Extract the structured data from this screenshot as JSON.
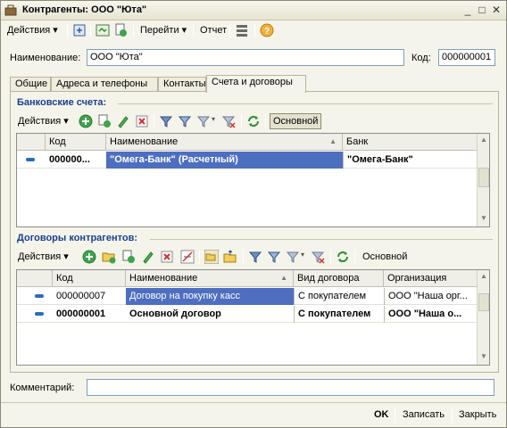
{
  "window": {
    "title": "Контрагенты: ООО \"Юта\""
  },
  "toolbar": {
    "actions": "Действия",
    "goto": "Перейти",
    "report": "Отчет"
  },
  "form": {
    "name_label": "Наименование:",
    "name_value": "ООО \"Юта\"",
    "code_label": "Код:",
    "code_value": "000000001",
    "comment_label": "Комментарий:",
    "comment_value": ""
  },
  "tabs": [
    {
      "label": "Общие"
    },
    {
      "label": "Адреса и телефоны"
    },
    {
      "label": "Контакты"
    },
    {
      "label": "Счета и договоры",
      "active": true
    }
  ],
  "bank_accounts": {
    "title": "Банковские счета:",
    "actions": "Действия",
    "main_button": "Основной",
    "columns": [
      "Код",
      "Наименование",
      "Банк"
    ],
    "rows": [
      {
        "code": "000000...",
        "name": "\"Омега-Банк\" (Расчетный)",
        "bank": "\"Омега-Банк\""
      }
    ]
  },
  "contracts": {
    "title": "Договоры контрагентов:",
    "actions": "Действия",
    "main_button": "Основной",
    "columns": [
      "Код",
      "Наименование",
      "Вид договора",
      "Организация"
    ],
    "rows": [
      {
        "code": "000000007",
        "name": "Договор на покупку касс",
        "kind": "С покупателем",
        "org": "ООО \"Наша орг...",
        "bold": false
      },
      {
        "code": "000000001",
        "name": "Основной договор",
        "kind": "С покупателем",
        "org": "ООО \"Наша о...",
        "bold": true
      }
    ]
  },
  "footer": {
    "ok": "OK",
    "save": "Записать",
    "close": "Закрыть"
  }
}
